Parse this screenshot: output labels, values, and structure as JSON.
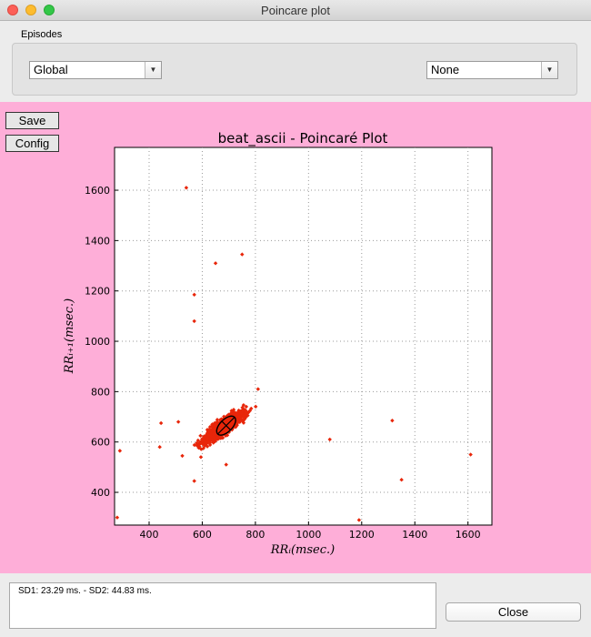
{
  "window": {
    "title": "Poincare plot"
  },
  "episodes": {
    "label": "Episodes",
    "left_select": "Global",
    "right_select": "None"
  },
  "toolbar": {
    "save_label": "Save",
    "config_label": "Config"
  },
  "chart_data": {
    "type": "scatter",
    "title": "beat_ascii - Poincaré Plot",
    "xlabel": "RRᵢ(msec.)",
    "ylabel": "RRᵢ₊₁(msec.)",
    "xlim": [
      270,
      1690
    ],
    "ylim": [
      270,
      1770
    ],
    "xticks": [
      400,
      600,
      800,
      1000,
      1200,
      1400,
      1600
    ],
    "yticks": [
      400,
      600,
      800,
      1000,
      1200,
      1400,
      1600
    ],
    "grid": true,
    "series": [
      {
        "color": "#e8260a",
        "points": [
          [
            540,
            1610
          ],
          [
            650,
            1310
          ],
          [
            750,
            1345
          ],
          [
            570,
            1185
          ],
          [
            570,
            1080
          ],
          [
            290,
            565
          ],
          [
            440,
            580
          ],
          [
            445,
            675
          ],
          [
            510,
            680
          ],
          [
            570,
            445
          ],
          [
            595,
            540
          ],
          [
            690,
            510
          ],
          [
            1080,
            610
          ],
          [
            1315,
            685
          ],
          [
            1350,
            450
          ],
          [
            1610,
            550
          ],
          [
            280,
            300
          ],
          [
            1190,
            290
          ],
          [
            810,
            810
          ],
          [
            525,
            545
          ]
        ],
        "cluster": {
          "center": [
            680,
            660
          ],
          "direction_angle_deg": 40,
          "spread_major": 72,
          "spread_minor": 18,
          "x_range": [
            540,
            810
          ],
          "count": 1500
        }
      }
    ],
    "ellipse": {
      "center": [
        690,
        665
      ],
      "sd1": 23.29,
      "sd2": 44.83,
      "angle_deg": 45,
      "color": "#000000"
    }
  },
  "stats": {
    "text": "SD1: 23.29 ms. - SD2: 44.83 ms."
  },
  "footer": {
    "close_label": "Close"
  }
}
